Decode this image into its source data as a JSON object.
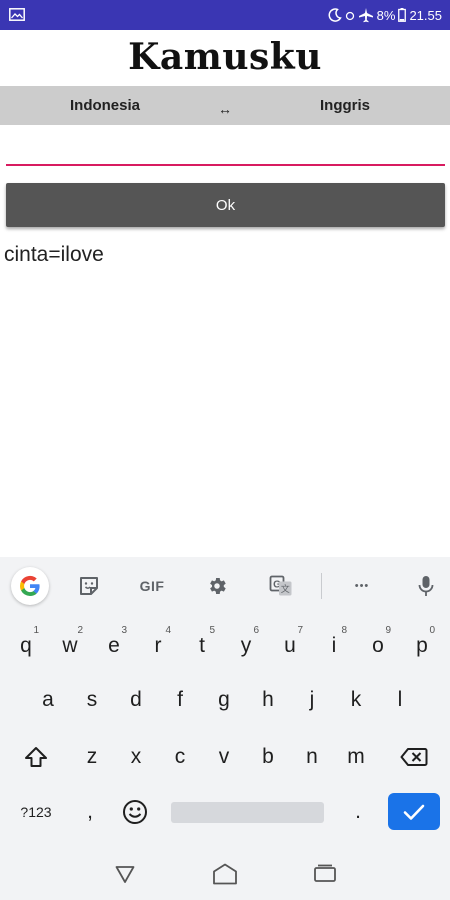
{
  "status_bar": {
    "battery_percent": "8%",
    "time": "21.55",
    "bg_color": "#3a36b3",
    "icons": [
      "gallery-icon",
      "moon-icon",
      "airplane-icon",
      "battery-icon"
    ]
  },
  "app": {
    "title": "Kamusku",
    "source_language": "Indonesia",
    "swap_symbol": "↔",
    "target_language": "Inggris",
    "input_value": "",
    "input_underline_color": "#d81b60",
    "ok_label": "Ok",
    "result": "cinta=ilove"
  },
  "keyboard": {
    "toolbar": [
      "google-icon",
      "sticker-icon",
      "gif-icon",
      "settings-icon",
      "translate-icon",
      "more-icon",
      "mic-icon"
    ],
    "gif_label": "GIF",
    "more_label": "•••",
    "row1": [
      {
        "key": "q",
        "hint": "1"
      },
      {
        "key": "w",
        "hint": "2"
      },
      {
        "key": "e",
        "hint": "3"
      },
      {
        "key": "r",
        "hint": "4"
      },
      {
        "key": "t",
        "hint": "5"
      },
      {
        "key": "y",
        "hint": "6"
      },
      {
        "key": "u",
        "hint": "7"
      },
      {
        "key": "i",
        "hint": "8"
      },
      {
        "key": "o",
        "hint": "9"
      },
      {
        "key": "p",
        "hint": "0"
      }
    ],
    "row2": [
      "a",
      "s",
      "d",
      "f",
      "g",
      "h",
      "j",
      "k",
      "l"
    ],
    "row3": [
      "z",
      "x",
      "c",
      "v",
      "b",
      "n",
      "m"
    ],
    "symbols_label": "?123",
    "comma_label": ",",
    "period_label": ".",
    "accent_color": "#1a73e8"
  },
  "nav_bar": {
    "buttons": [
      "back-icon",
      "home-icon",
      "recents-icon"
    ]
  }
}
